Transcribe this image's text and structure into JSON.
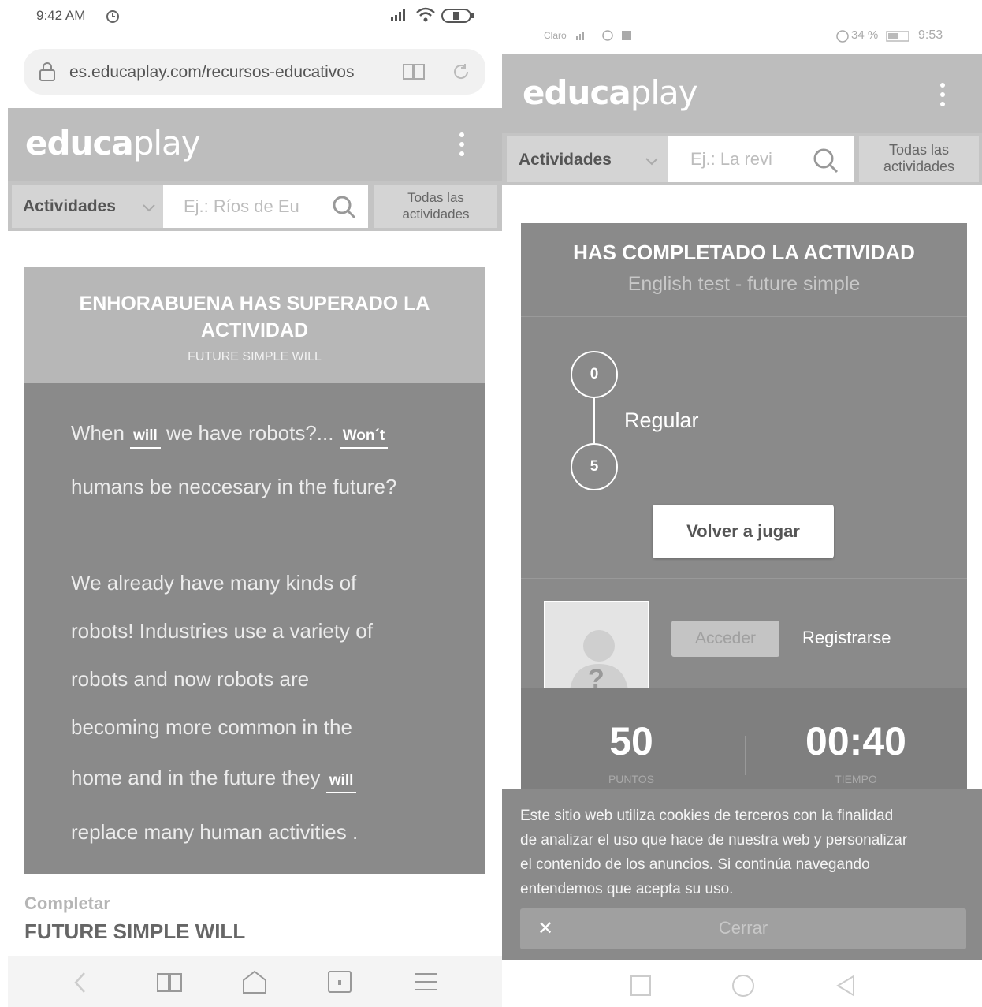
{
  "left": {
    "status": {
      "time": "9:42 AM"
    },
    "url": "es.educaplay.com/recursos-educativos",
    "header": {
      "logo_bold": "educa",
      "logo_light": "play"
    },
    "search": {
      "category": "Actividades",
      "placeholder": "Ej.: Ríos de Eu",
      "all_line1": "Todas las",
      "all_line2": "actividades"
    },
    "result": {
      "title_line1": "ENHORABUENA HAS SUPERADO LA",
      "title_line2": "ACTIVIDAD",
      "subtitle": "FUTURE SIMPLE WILL"
    },
    "passage": {
      "l1_a": "When",
      "l1_blank1": "will",
      "l1_b": "we have robots?...",
      "l1_blank2": "Won´t",
      "l2": "humans be neccesary in the future?",
      "l3": "We already have many kinds of",
      "l4": "robots! Industries use a variety of",
      "l5": "robots and now robots are",
      "l6": "becoming more common in the",
      "l7_a": "home and in the future they",
      "l7_blank": "will",
      "l8": "replace many human activities ."
    },
    "footer": {
      "type": "Completar",
      "title": "FUTURE SIMPLE WILL"
    }
  },
  "right": {
    "status": {
      "carrier": "Claro",
      "battery": "34 %",
      "time": "9:53"
    },
    "header": {
      "logo_bold": "educa",
      "logo_light": "play"
    },
    "search": {
      "category": "Actividades",
      "placeholder": "Ej.: La revi",
      "all_line1": "Todas las",
      "all_line2": "actividades"
    },
    "result": {
      "title": "HAS COMPLETADO LA ACTIVIDAD",
      "subtitle": "English test - future simple",
      "scale_top": "0",
      "scale_bottom": "5",
      "rating": "Regular",
      "replay": "Volver a jugar",
      "login": "Acceder",
      "register": "Registrarse",
      "avatar_mark": "?",
      "points_value": "50",
      "points_label": "PUNTOS",
      "time_value": "00:40",
      "time_label": "TIEMPO"
    },
    "cookies": {
      "line1": "Este sitio web utiliza cookies de terceros con la finalidad",
      "line2": "de analizar el uso que hace de nuestra web y personalizar",
      "line3": "el contenido de los anuncios. Si continúa navegando",
      "line4": "entendemos que acepta su uso.",
      "close_mark": "✕",
      "close": "Cerrar"
    }
  }
}
